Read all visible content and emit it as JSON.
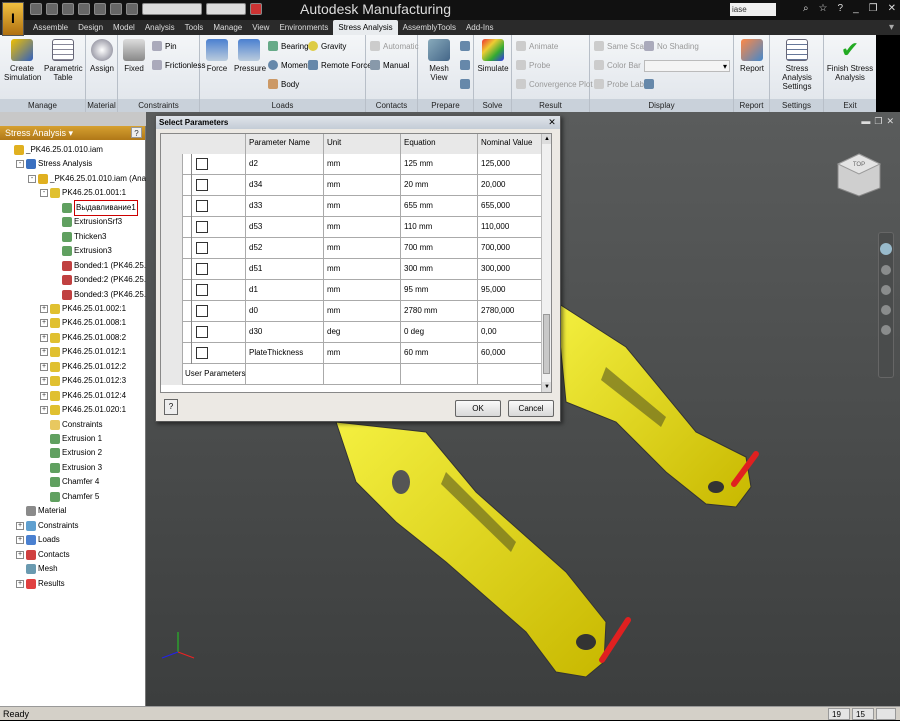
{
  "window": {
    "title": "Autodesk Manufacturing",
    "search_text": "iase",
    "logo_text": "I",
    "logo_sub": "PRO"
  },
  "ribbon_tabs": [
    "Assemble",
    "Design",
    "Model",
    "Analysis",
    "Tools",
    "Manage",
    "View",
    "Environments",
    "Stress Analysis",
    "AssemblyTools",
    "Add-Ins"
  ],
  "active_tab": "Stress Analysis",
  "ribbon": {
    "manage": {
      "label": "Manage",
      "create_simulation": "Create Simulation",
      "parametric_table": "Parametric Table"
    },
    "material": {
      "label": "Material",
      "assign": "Assign"
    },
    "constraints": {
      "label": "Constraints",
      "fixed": "Fixed",
      "pin": "Pin",
      "frictionless": "Frictionless"
    },
    "loads": {
      "label": "Loads",
      "force": "Force",
      "pressure": "Pressure",
      "bearing": "Bearing",
      "moment": "Moment",
      "body": "Body",
      "gravity": "Gravity",
      "remote_force": "Remote Force"
    },
    "contacts": {
      "label": "Contacts",
      "automatic": "Automatic",
      "manual": "Manual"
    },
    "prepare": {
      "label": "Prepare",
      "mesh_view": "Mesh View"
    },
    "solve": {
      "label": "Solve",
      "simulate": "Simulate"
    },
    "result": {
      "label": "Result",
      "animate": "Animate",
      "probe": "Probe",
      "convergence_plot": "Convergence Plot"
    },
    "display": {
      "label": "Display",
      "same_scale": "Same Scale",
      "color_bar": "Color Bar",
      "probe_labels": "Probe Labels",
      "no_shading": "No Shading"
    },
    "report": {
      "label": "Report",
      "report": "Report"
    },
    "settings": {
      "label": "Settings",
      "stress_settings": "Stress Analysis Settings"
    },
    "exit": {
      "label": "Exit",
      "finish": "Finish Stress Analysis"
    }
  },
  "browser": {
    "title": "Stress Analysis ▾",
    "help": "?",
    "nodes": [
      {
        "label": "_PK46.25.01.010.iam",
        "indent": 0,
        "icon": "assembly",
        "exp": ""
      },
      {
        "label": "Stress Analysis",
        "indent": 1,
        "icon": "analysis",
        "exp": "-"
      },
      {
        "label": "_PK46.25.01.010.iam (Analysis)",
        "indent": 2,
        "icon": "assembly",
        "exp": "-"
      },
      {
        "label": "PK46.25.01.001:1",
        "indent": 3,
        "icon": "part",
        "exp": "-"
      },
      {
        "label": "Выдавливание1",
        "indent": 4,
        "icon": "feature",
        "exp": "",
        "selected": true
      },
      {
        "label": "ExtrusionSrf3",
        "indent": 4,
        "icon": "feature",
        "exp": ""
      },
      {
        "label": "Thicken3",
        "indent": 4,
        "icon": "feature",
        "exp": ""
      },
      {
        "label": "Extrusion3",
        "indent": 4,
        "icon": "feature",
        "exp": ""
      },
      {
        "label": "Bonded:1 (PK46.25.01.00",
        "indent": 4,
        "icon": "bond",
        "exp": ""
      },
      {
        "label": "Bonded:2 (PK46.25.01.00",
        "indent": 4,
        "icon": "bond",
        "exp": ""
      },
      {
        "label": "Bonded:3 (PK46.25.01.00",
        "indent": 4,
        "icon": "bond",
        "exp": ""
      },
      {
        "label": "PK46.25.01.002:1",
        "indent": 3,
        "icon": "part",
        "exp": "+"
      },
      {
        "label": "PK46.25.01.008:1",
        "indent": 3,
        "icon": "part",
        "exp": "+"
      },
      {
        "label": "PK46.25.01.008:2",
        "indent": 3,
        "icon": "part",
        "exp": "+"
      },
      {
        "label": "PK46.25.01.012:1",
        "indent": 3,
        "icon": "part",
        "exp": "+"
      },
      {
        "label": "PK46.25.01.012:2",
        "indent": 3,
        "icon": "part",
        "exp": "+"
      },
      {
        "label": "PK46.25.01.012:3",
        "indent": 3,
        "icon": "part",
        "exp": "+"
      },
      {
        "label": "PK46.25.01.012:4",
        "indent": 3,
        "icon": "part",
        "exp": "+"
      },
      {
        "label": "PK46.25.01.020:1",
        "indent": 3,
        "icon": "part",
        "exp": "+"
      },
      {
        "label": "Constraints",
        "indent": 3,
        "icon": "folder",
        "exp": ""
      },
      {
        "label": "Extrusion 1",
        "indent": 3,
        "icon": "feature",
        "exp": ""
      },
      {
        "label": "Extrusion 2",
        "indent": 3,
        "icon": "feature",
        "exp": ""
      },
      {
        "label": "Extrusion 3",
        "indent": 3,
        "icon": "feature",
        "exp": ""
      },
      {
        "label": "Chamfer 4",
        "indent": 3,
        "icon": "feature",
        "exp": ""
      },
      {
        "label": "Chamfer 5",
        "indent": 3,
        "icon": "feature",
        "exp": ""
      },
      {
        "label": "Material",
        "indent": 1,
        "icon": "material",
        "exp": ""
      },
      {
        "label": "Constraints",
        "indent": 1,
        "icon": "constraints",
        "exp": "+"
      },
      {
        "label": "Loads",
        "indent": 1,
        "icon": "loads",
        "exp": "+"
      },
      {
        "label": "Contacts",
        "indent": 1,
        "icon": "contacts",
        "exp": "+"
      },
      {
        "label": "Mesh",
        "indent": 1,
        "icon": "mesh",
        "exp": ""
      },
      {
        "label": "Results",
        "indent": 1,
        "icon": "results",
        "exp": "+"
      }
    ]
  },
  "dialog": {
    "title": "Select Parameters",
    "close": "✕",
    "headers": [
      "",
      "Parameter Name",
      "Unit",
      "Equation",
      "Nominal Value"
    ],
    "rows": [
      {
        "name": "d2",
        "unit": "mm",
        "equation": "125 mm",
        "nominal": "125,000"
      },
      {
        "name": "d34",
        "unit": "mm",
        "equation": "20 mm",
        "nominal": "20,000"
      },
      {
        "name": "d33",
        "unit": "mm",
        "equation": "655 mm",
        "nominal": "655,000"
      },
      {
        "name": "d53",
        "unit": "mm",
        "equation": "110 mm",
        "nominal": "110,000"
      },
      {
        "name": "d52",
        "unit": "mm",
        "equation": "700 mm",
        "nominal": "700,000"
      },
      {
        "name": "d51",
        "unit": "mm",
        "equation": "300 mm",
        "nominal": "300,000"
      },
      {
        "name": "d1",
        "unit": "mm",
        "equation": "95 mm",
        "nominal": "95,000"
      },
      {
        "name": "d0",
        "unit": "mm",
        "equation": "2780 mm",
        "nominal": "2780,000"
      },
      {
        "name": "d30",
        "unit": "deg",
        "equation": "0 deg",
        "nominal": "0,00"
      },
      {
        "name": "PlateThickness",
        "unit": "mm",
        "equation": "60 mm",
        "nominal": "60,000"
      }
    ],
    "group_label": "User Parameters",
    "ok": "OK",
    "cancel": "Cancel",
    "help": "?"
  },
  "viewcube_label": "TOP",
  "status": {
    "text": "Ready",
    "field1": "19",
    "field2": "15"
  },
  "colors": {
    "part_yellow": "#e6e012",
    "arrow_red": "#e02020",
    "viewport_bg": "#4a4c4c",
    "browser_header": "#c88c24"
  }
}
